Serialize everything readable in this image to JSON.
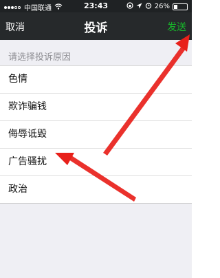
{
  "status_bar": {
    "carrier": "中国联通",
    "time": "23:43",
    "battery": "26%",
    "battery_level": 0.26
  },
  "nav": {
    "cancel_label": "取消",
    "title": "投诉",
    "send_label": "发送"
  },
  "hint": "请选择投诉原因",
  "reasons": [
    "色情",
    "欺诈骗钱",
    "侮辱诋毁",
    "广告骚扰",
    "政治"
  ],
  "colors": {
    "nav_background": "#26292b",
    "send_green": "#17b52a",
    "arrow_red": "#e8201a",
    "page_background": "#efeff4"
  }
}
